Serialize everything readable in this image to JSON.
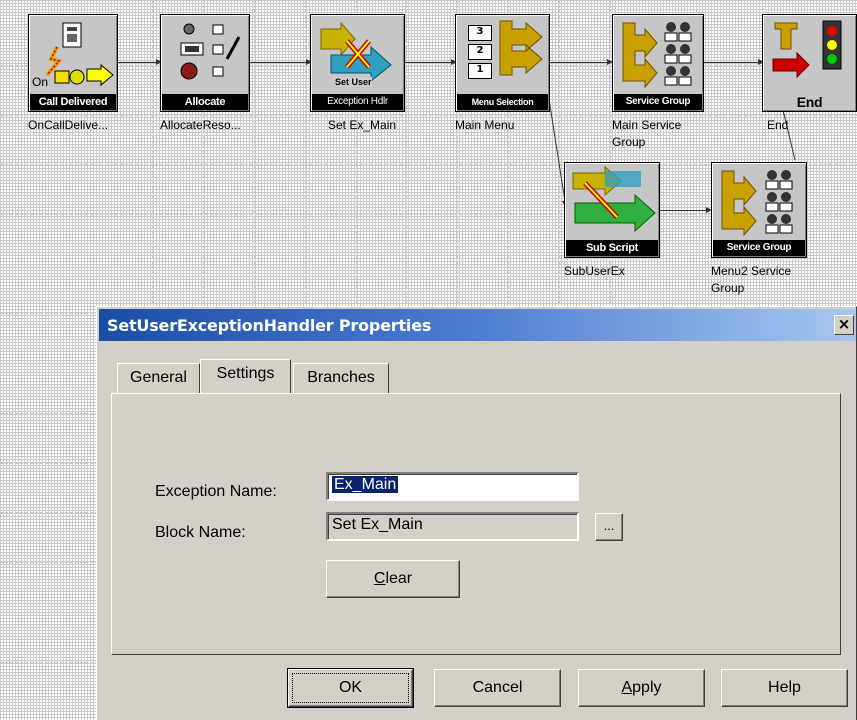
{
  "workflow": {
    "blocks": [
      {
        "name": "OnCallDelivered",
        "caption": "Call Delivered",
        "label": "OnCallDelive...",
        "tiny": "On"
      },
      {
        "name": "AllocateResource",
        "caption": "Allocate",
        "label": "AllocateReso..."
      },
      {
        "name": "SetExMain",
        "caption": "Exception Hdlr",
        "label": "Set Ex_Main",
        "tiny": "Set User"
      },
      {
        "name": "MainMenu",
        "caption": "Menu Selection",
        "label": "Main Menu",
        "tiny_items": [
          "3",
          "2",
          "1"
        ]
      },
      {
        "name": "MainServiceGroup",
        "caption": "Service Group",
        "label": "Main Service",
        "label2": "Group"
      },
      {
        "name": "End",
        "caption": "End",
        "label": "End"
      },
      {
        "name": "SubUserEx",
        "caption": "Sub Script",
        "label": "SubUserEx"
      },
      {
        "name": "Menu2ServiceGroup",
        "caption": "Service Group",
        "label": "Menu2 Service",
        "label2": "Group"
      }
    ]
  },
  "dialog": {
    "title": "SetUserExceptionHandler Properties",
    "close_glyph": "×",
    "tabs": [
      {
        "label": "General",
        "active": false
      },
      {
        "label": "Settings",
        "active": true
      },
      {
        "label": "Branches",
        "active": false
      }
    ],
    "fields": {
      "exception_name_label": "Exception Name:",
      "exception_name_value": "Ex_Main",
      "block_name_label": "Block Name:",
      "block_name_value": "Set Ex_Main",
      "browse_label": "...",
      "clear_label": "Clear",
      "clear_mnemonic": "C",
      "clear_rest": "lear"
    },
    "buttons": {
      "ok": "OK",
      "cancel": "Cancel",
      "apply_mnemonic": "A",
      "apply_rest": "pply",
      "help": "Help"
    }
  },
  "colors": {
    "titlebar_start": "#1a4ea5",
    "titlebar_end": "#a6c8f0",
    "dialog_bg": "#d4d0c8",
    "selection": "#0a246a"
  }
}
